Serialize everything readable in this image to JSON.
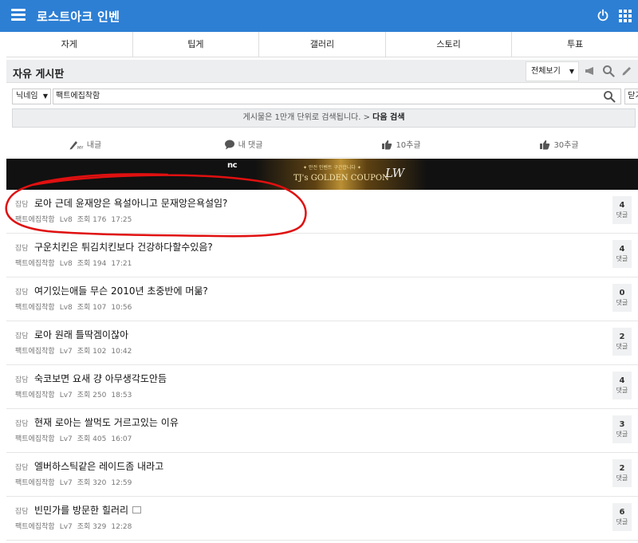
{
  "header": {
    "title": "로스트아크 인벤",
    "icons": [
      "menu-icon",
      "power-icon",
      "apps-grid-icon"
    ]
  },
  "tabs": [
    "자게",
    "팁게",
    "갤러리",
    "스토리",
    "투표"
  ],
  "board": {
    "title": "자유 게시판",
    "view_select": "전체보기",
    "icons": [
      "megaphone-icon",
      "search-icon",
      "pencil-icon"
    ]
  },
  "search": {
    "field_select": "닉네임",
    "query": "팩트에집착함",
    "close_label": "닫기"
  },
  "notice": {
    "text": "게시물은 1만개 단위로 검색됩니다. >",
    "next_label": "다음 검색"
  },
  "filters": [
    {
      "label": "내글",
      "icon": "my-post-icon"
    },
    {
      "label": "내 댓글",
      "icon": "speech-bubble-icon"
    },
    {
      "label": "10추글",
      "icon": "thumbs-up-icon"
    },
    {
      "label": "30추글",
      "icon": "thumbs-up-icon"
    }
  ],
  "banner": {
    "brand": "nc",
    "subtitle": "✦ 안전 인벤트 구간합니다 ✦",
    "text": "TJ's GOLDEN COUPON",
    "logo": "LW"
  },
  "posts": [
    {
      "category": "잡담",
      "title": "로아 근데 윤재앙은 욕설아니고 문재앙은욕설임?",
      "author": "팩트에집착함",
      "level": "Lv8",
      "views": "조회 176",
      "time": "17:25",
      "comments": "4",
      "comment_label": "댓글",
      "has_image": false
    },
    {
      "category": "잡담",
      "title": "구운치킨은 튀김치킨보다 건강하다할수있음?",
      "author": "팩트에집착함",
      "level": "Lv8",
      "views": "조회 194",
      "time": "17:21",
      "comments": "4",
      "comment_label": "댓글",
      "has_image": false
    },
    {
      "category": "잡담",
      "title": "여기있는애들 무슨 2010년 초중반에 머묾?",
      "author": "팩트에집착함",
      "level": "Lv8",
      "views": "조회 107",
      "time": "10:56",
      "comments": "0",
      "comment_label": "댓글",
      "has_image": false
    },
    {
      "category": "잡담",
      "title": "로아 원래 틀딱겜이잖아",
      "author": "팩트에집착함",
      "level": "Lv7",
      "views": "조회 102",
      "time": "10:42",
      "comments": "2",
      "comment_label": "댓글",
      "has_image": false
    },
    {
      "category": "잡담",
      "title": "숙코보면 요새 걍 아무생각도안듬",
      "author": "팩트에집착함",
      "level": "Lv7",
      "views": "조회 250",
      "time": "18:53",
      "comments": "4",
      "comment_label": "댓글",
      "has_image": false
    },
    {
      "category": "잡담",
      "title": "현재 로아는 쌀먹도 거르고있는 이유",
      "author": "팩트에집착함",
      "level": "Lv7",
      "views": "조회 405",
      "time": "16:07",
      "comments": "3",
      "comment_label": "댓글",
      "has_image": false
    },
    {
      "category": "잡담",
      "title": "엘버하스틱같은 레이드좀 내라고",
      "author": "팩트에집착함",
      "level": "Lv7",
      "views": "조회 320",
      "time": "12:59",
      "comments": "2",
      "comment_label": "댓글",
      "has_image": false
    },
    {
      "category": "잡담",
      "title": "빈민가를 방문한 힐러리",
      "author": "팩트에집착함",
      "level": "Lv7",
      "views": "조회 329",
      "time": "12:28",
      "comments": "6",
      "comment_label": "댓글",
      "has_image": true
    }
  ],
  "colors": {
    "header_bg": "#2d7fd4",
    "annotation_red": "#e01010"
  }
}
